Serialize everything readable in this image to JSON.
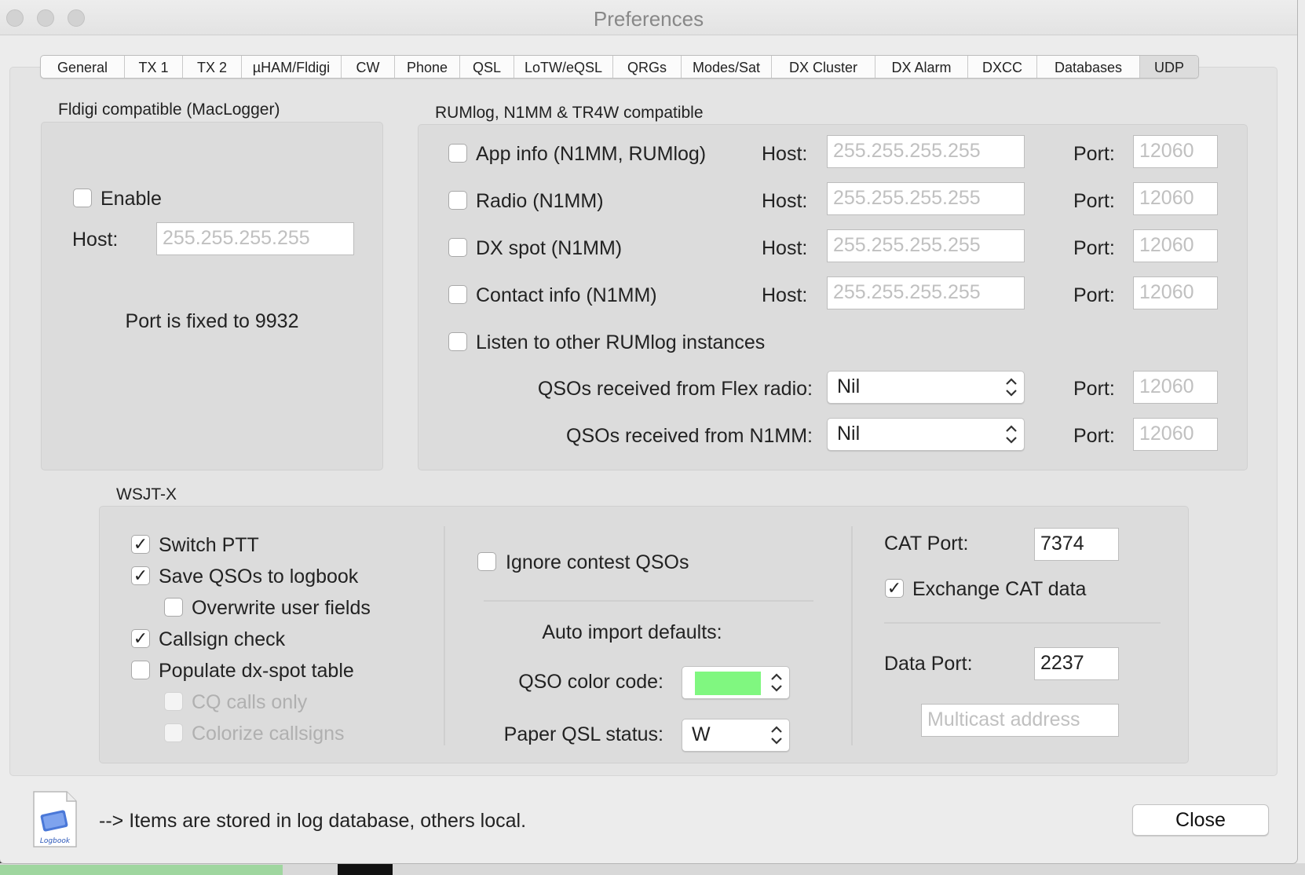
{
  "window": {
    "title": "Preferences"
  },
  "tabs": [
    "General",
    "TX 1",
    "TX 2",
    "µHAM/Fldigi",
    "CW",
    "Phone",
    "QSL",
    "LoTW/eQSL",
    "QRGs",
    "Modes/Sat",
    "DX Cluster",
    "DX Alarm",
    "DXCC",
    "Databases",
    "UDP"
  ],
  "active_tab": "UDP",
  "fldigi": {
    "title": "Fldigi compatible (MacLogger)",
    "enable_label": "Enable",
    "enable_checked": false,
    "host_label": "Host:",
    "host_placeholder": "255.255.255.255",
    "port_note": "Port is fixed to 9932"
  },
  "rumlog": {
    "title": "RUMlog, N1MM & TR4W compatible",
    "host_label": "Host:",
    "port_label": "Port:",
    "host_placeholder": "255.255.255.255",
    "port_placeholder": "12060",
    "rows": [
      {
        "label": "App info (N1MM, RUMlog)",
        "checked": false
      },
      {
        "label": "Radio (N1MM)",
        "checked": false
      },
      {
        "label": "DX spot (N1MM)",
        "checked": false
      },
      {
        "label": "Contact info (N1MM)",
        "checked": false
      }
    ],
    "listen_label": "Listen to other RUMlog instances",
    "listen_checked": false,
    "flex_label": "QSOs received from Flex radio:",
    "flex_value": "Nil",
    "n1mm_label": "QSOs received from N1MM:",
    "n1mm_value": "Nil"
  },
  "wsjtx": {
    "title": "WSJT-X",
    "switch_ptt": {
      "label": "Switch PTT",
      "checked": true
    },
    "save_qsos": {
      "label": "Save QSOs to logbook",
      "checked": true
    },
    "overwrite": {
      "label": "Overwrite user fields",
      "checked": false
    },
    "callsign_check": {
      "label": "Callsign check",
      "checked": true
    },
    "populate": {
      "label": "Populate dx-spot table",
      "checked": false
    },
    "cq_only": {
      "label": "CQ calls only",
      "checked": false
    },
    "colorize": {
      "label": "Colorize callsigns",
      "checked": false
    },
    "ignore_contest": {
      "label": "Ignore contest QSOs",
      "checked": false
    },
    "auto_import_label": "Auto import defaults:",
    "color_code_label": "QSO color code:",
    "color_code_value": "#80f780",
    "paper_qsl_label": "Paper QSL status:",
    "paper_qsl_value": "W",
    "cat_port_label": "CAT Port:",
    "cat_port_value": "7374",
    "exchange_cat": {
      "label": "Exchange CAT data",
      "checked": true
    },
    "data_port_label": "Data Port:",
    "data_port_value": "2237",
    "multicast_placeholder": "Multicast address"
  },
  "footer": {
    "note": "--> Items are stored in log database, others local.",
    "icon_text": "Logbook",
    "close_label": "Close"
  }
}
